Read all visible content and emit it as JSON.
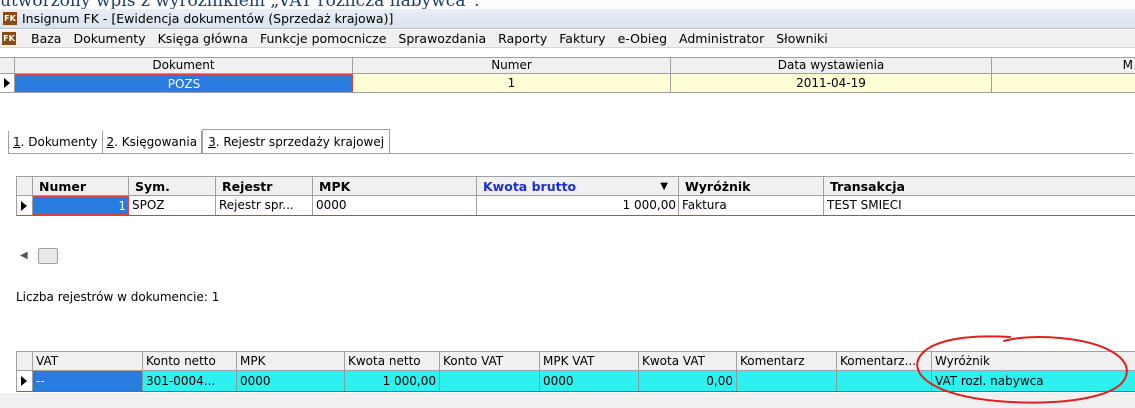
{
  "caption": "utworzony wpis z wyróżnikiem „VAT rozlicza nabywca”.",
  "window": {
    "icon_text": "FK",
    "title": "Insignum FK - [Ewidencja dokumentów (Sprzedaż krajowa)]"
  },
  "menu": {
    "icon_text": "FK",
    "items": [
      "Baza",
      "Dokumenty",
      "Księga główna",
      "Funkcje pomocnicze",
      "Sprawozdania",
      "Raporty",
      "Faktury",
      "e-Obieg",
      "Administrator",
      "Słowniki"
    ]
  },
  "header_grid": {
    "columns": [
      "Dokument",
      "Numer",
      "Data wystawienia",
      "M"
    ],
    "row": {
      "dokument": "POZS",
      "numer": "1",
      "data": "2011-04-19"
    },
    "colors": {
      "selected": "#2a7be0",
      "cream": "#ffffd6"
    }
  },
  "tabs": [
    {
      "key": "1",
      "label": ". Dokumenty"
    },
    {
      "key": "2",
      "label": ". Księgowania"
    },
    {
      "key": "3",
      "label": ". Rejestr sprzedaży krajowej"
    }
  ],
  "register_grid": {
    "columns": [
      "Numer",
      "Sym.",
      "Rejestr",
      "MPK",
      "Kwota brutto",
      "Wyróżnik",
      "Transakcja"
    ],
    "sort_icon": "sort-desc-icon",
    "row": {
      "numer": "1",
      "sym": "SPOZ",
      "rejestr": "Rejestr spr...",
      "mpk": "0000",
      "kwota_brutto": "1 000,00",
      "wyroznik": "Faktura",
      "transakcja": "TEST SMIECI"
    }
  },
  "scrollbar": {
    "left_arrow": "◀"
  },
  "register_count": "Liczba rejestrów w dokumencie: 1",
  "vat_grid": {
    "columns": [
      "VAT",
      "Konto netto",
      "MPK",
      "Kwota netto",
      "Konto VAT",
      "MPK VAT",
      "Kwota VAT",
      "Komentarz",
      "Komentarz...",
      "Wyróżnik"
    ],
    "row": {
      "vat": "--",
      "konto_netto": "301-0004...",
      "mpk": "0000",
      "kwota_netto": "1 000,00",
      "konto_vat": "",
      "mpk_vat": "0000",
      "kwota_vat": "0,00",
      "komentarz": "",
      "komentarz2": "",
      "wyroznik": "VAT rozl. nabywca"
    },
    "row_color": "#2ff0f0"
  },
  "annotation": {
    "color": "#e02020"
  }
}
